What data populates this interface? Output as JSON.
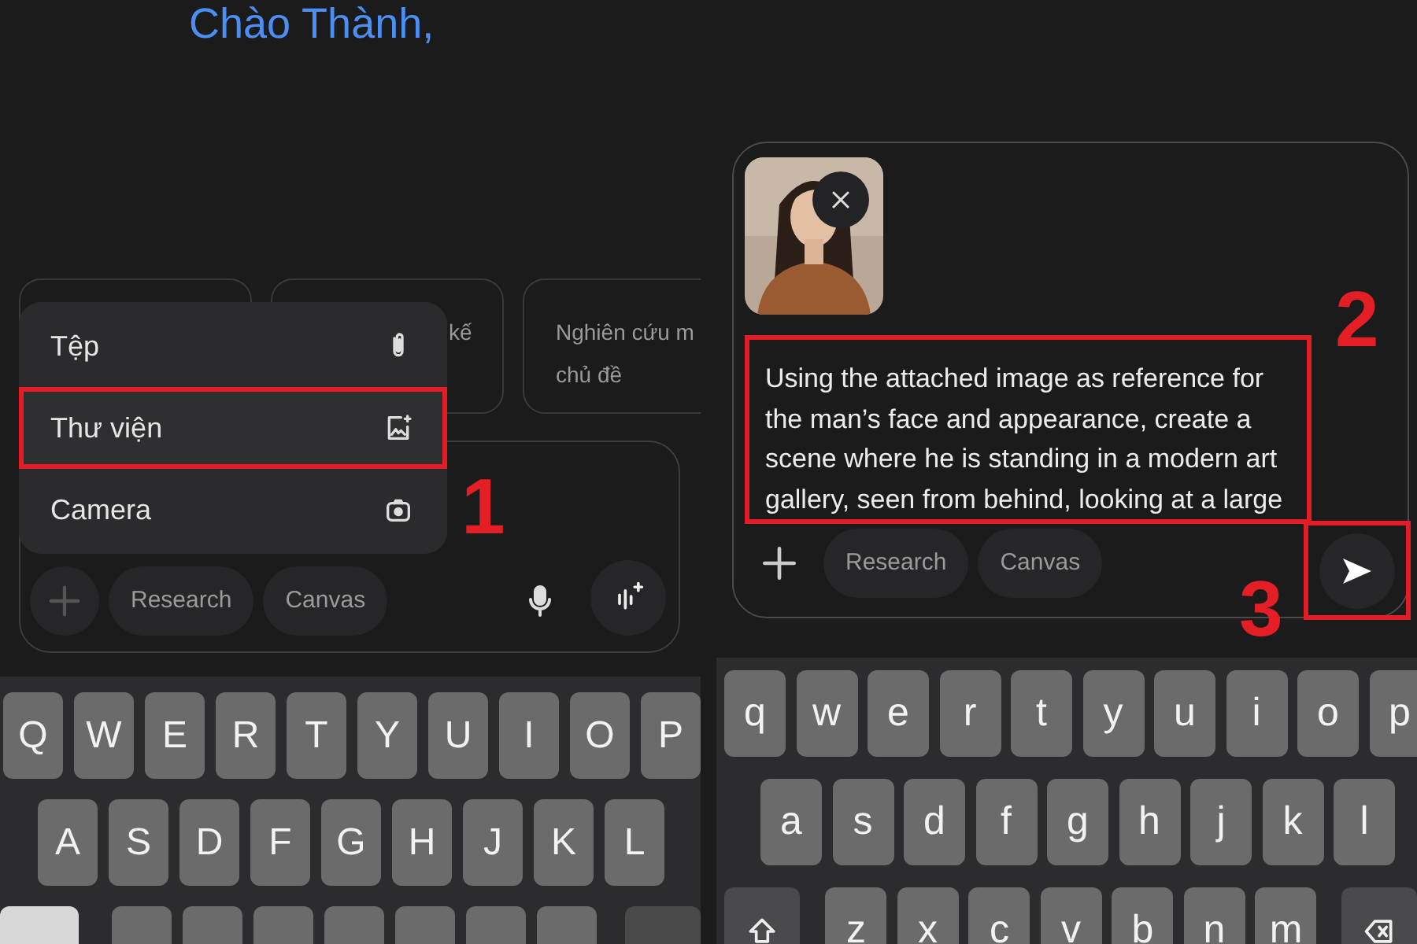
{
  "left_screen": {
    "greeting": "Chào Thành,",
    "suggestion_cards": [
      {
        "lines": [
          "kế"
        ]
      },
      {
        "lines": [
          "Nghiên cứu m",
          "chủ đề"
        ]
      }
    ],
    "attach_menu": [
      {
        "label": "Tệp",
        "kind": "file",
        "highlighted": false
      },
      {
        "label": "Thư viện",
        "kind": "gallery",
        "highlighted": true
      },
      {
        "label": "Camera",
        "kind": "camera",
        "highlighted": false
      }
    ],
    "chips": [
      "Research",
      "Canvas"
    ],
    "keyboard_rows": [
      [
        "Q",
        "W",
        "E",
        "R",
        "T",
        "Y",
        "U",
        "I",
        "O",
        "P"
      ],
      [
        "A",
        "S",
        "D",
        "F",
        "G",
        "H",
        "J",
        "K",
        "L"
      ]
    ],
    "callout": "1"
  },
  "right_screen": {
    "attachment": {
      "kind": "picture"
    },
    "prompt": {
      "text": "Using the attached image as reference for the man’s face and appearance, create a scene where he is standing in a modern art gallery, seen from behind, looking at a large",
      "highlighted": true
    },
    "chips": [
      "Research",
      "Canvas"
    ],
    "send_button": {
      "highlighted": true
    },
    "callouts": [
      "2",
      "3"
    ],
    "keyboard_rows": [
      [
        "q",
        "w",
        "e",
        "r",
        "t",
        "y",
        "u",
        "i",
        "o",
        "p"
      ],
      [
        "a",
        "s",
        "d",
        "f",
        "g",
        "h",
        "j",
        "k",
        "l"
      ],
      [
        "z",
        "x",
        "c",
        "v",
        "b",
        "n",
        "m"
      ]
    ]
  }
}
